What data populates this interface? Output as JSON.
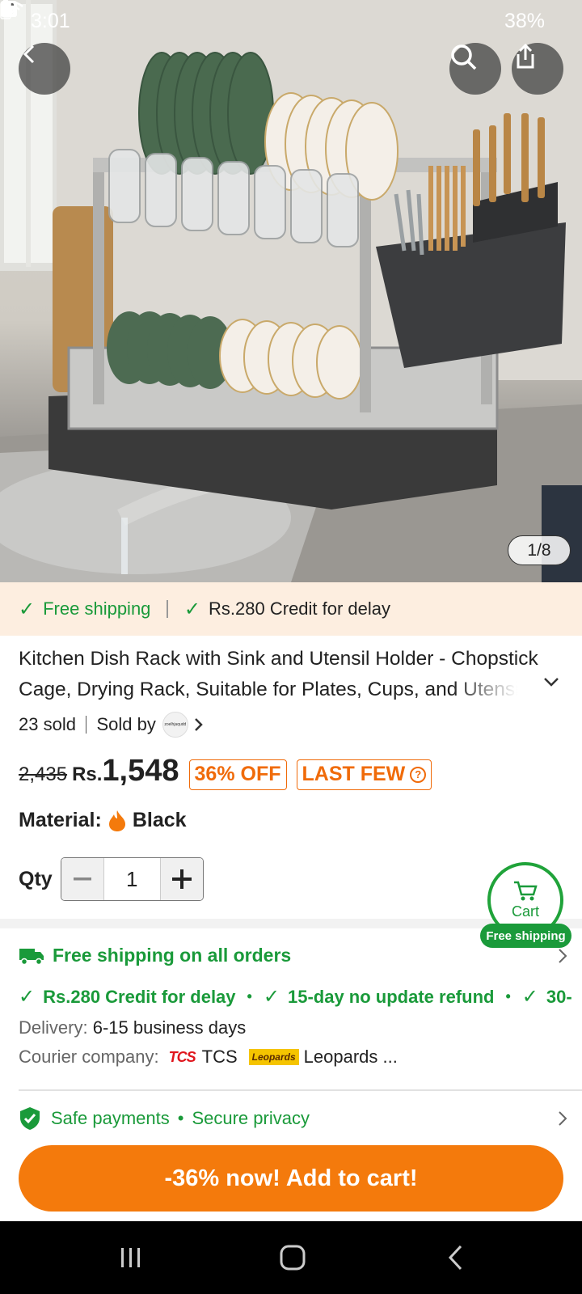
{
  "status_bar": {
    "time": "3:01",
    "battery": "38%"
  },
  "gallery": {
    "counter": "1/8"
  },
  "promo_strip": {
    "item1": "Free shipping",
    "item2": "Rs.280 Credit for delay"
  },
  "product": {
    "title": "Kitchen Dish Rack with Sink and Utensil Holder - Chopstick Cage, Drying Rack, Suitable for Plates, Cups, and Utensils",
    "sold": "23 sold",
    "sold_by": "Sold by",
    "seller_logo_text": "zoelhjaqudd",
    "old_price": "2,435",
    "currency": "Rs.",
    "price": "1,548",
    "discount_badge": "36% OFF",
    "stock_badge": "LAST FEW"
  },
  "material": {
    "label": "Material:",
    "value": "Black"
  },
  "quantity": {
    "label": "Qty",
    "value": "1"
  },
  "cart_float": {
    "label": "Cart",
    "badge": "Free shipping"
  },
  "shipping": {
    "headline": "Free shipping on all orders",
    "perks": [
      "Rs.280 Credit for delay",
      "15-day no update refund",
      "30-"
    ],
    "delivery_label": "Delivery:",
    "delivery_value": "6-15 business days",
    "courier_label": "Courier company:",
    "courier1_logo": "TCS",
    "courier1": "TCS",
    "courier2_logo": "Leopards",
    "courier2": "Leopards ..."
  },
  "safety": {
    "item1": "Safe payments",
    "item2": "Secure privacy"
  },
  "cta": {
    "label": "-36% now! Add to cart!"
  },
  "colors": {
    "accent_orange": "#f47a0c",
    "green": "#1a9a3a",
    "promo_bg": "#fdeee0"
  }
}
